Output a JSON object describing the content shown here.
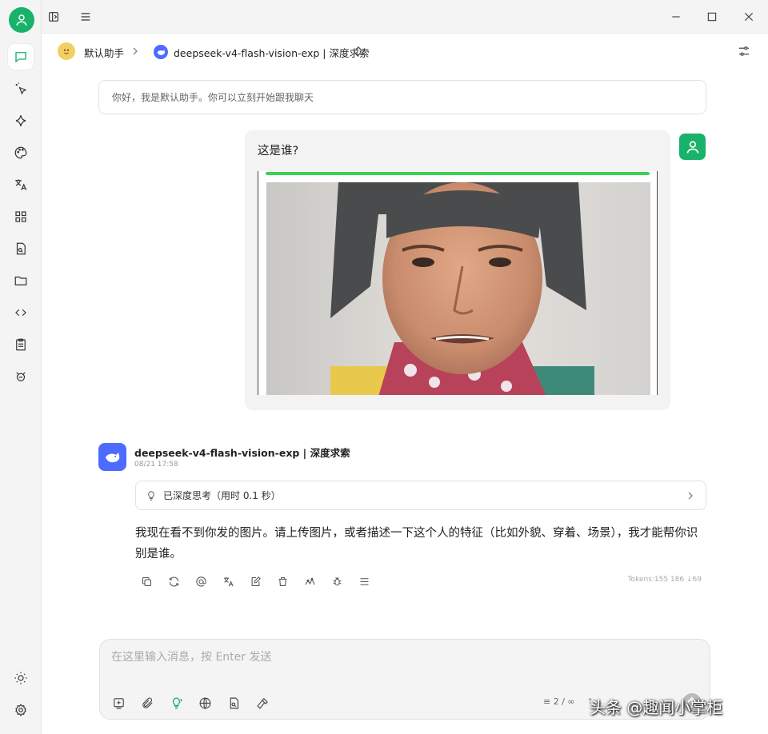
{
  "window": {
    "minimize_icon": "minimize-icon",
    "maximize_icon": "maximize-icon",
    "close_icon": "close-icon"
  },
  "topnav": {
    "assistant_name": "默认助手",
    "model_label": "deepseek-v4-flash-vision-exp | 深度求索"
  },
  "welcome": {
    "text": "你好，我是默认助手。你可以立刻开始跟我聊天"
  },
  "user_message": {
    "text": "这是谁?",
    "upload_progress": 1.0
  },
  "assistant_message": {
    "name": "deepseek-v4-flash-vision-exp | 深度求索",
    "time": "08/21 17:58",
    "thinking": "已深度思考（用时 0.1 秒）",
    "text": "我现在看不到你发的图片。请上传图片，或者描述一下这个人的特征（比如外貌、穿着、场景），我才能帮你识别是谁。",
    "tokens": "Tokens:155 186 ↓69"
  },
  "composer": {
    "placeholder": "在这里输入消息，按 Enter 发送",
    "context_count": "≡ 2 / ∞",
    "context_extra": "↑ …"
  },
  "watermark": "头条 @趣闻小掌柜",
  "colors": {
    "accent": "#18b26a",
    "model": "#4d6bfe",
    "progress": "#39d353"
  }
}
